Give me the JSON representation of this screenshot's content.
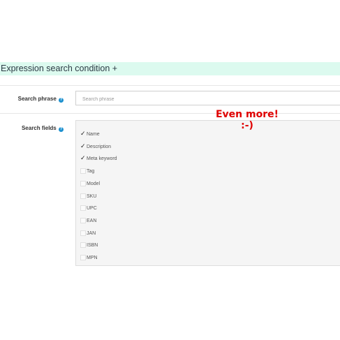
{
  "panel": {
    "title": "Expression search condition +"
  },
  "search_phrase": {
    "label": "Search phrase",
    "placeholder": "Search phrase",
    "value": ""
  },
  "search_fields": {
    "label": "Search fields",
    "options": [
      {
        "label": "Name",
        "checked": true
      },
      {
        "label": "Description",
        "checked": true
      },
      {
        "label": "Meta keyword",
        "checked": true
      },
      {
        "label": "Tag",
        "checked": false
      },
      {
        "label": "Model",
        "checked": false
      },
      {
        "label": "SKU",
        "checked": false
      },
      {
        "label": "UPC",
        "checked": false
      },
      {
        "label": "EAN",
        "checked": false
      },
      {
        "label": "JAN",
        "checked": false
      },
      {
        "label": "ISBN",
        "checked": false
      },
      {
        "label": "MPN",
        "checked": false
      }
    ]
  },
  "annotation": {
    "line1": "Even more!",
    "line2": ":-)"
  },
  "colors": {
    "heading_bg": "#dcfaef",
    "help_icon": "#1e91cf",
    "annotation": "#e00000",
    "fields_bg": "#f5f5f5"
  }
}
